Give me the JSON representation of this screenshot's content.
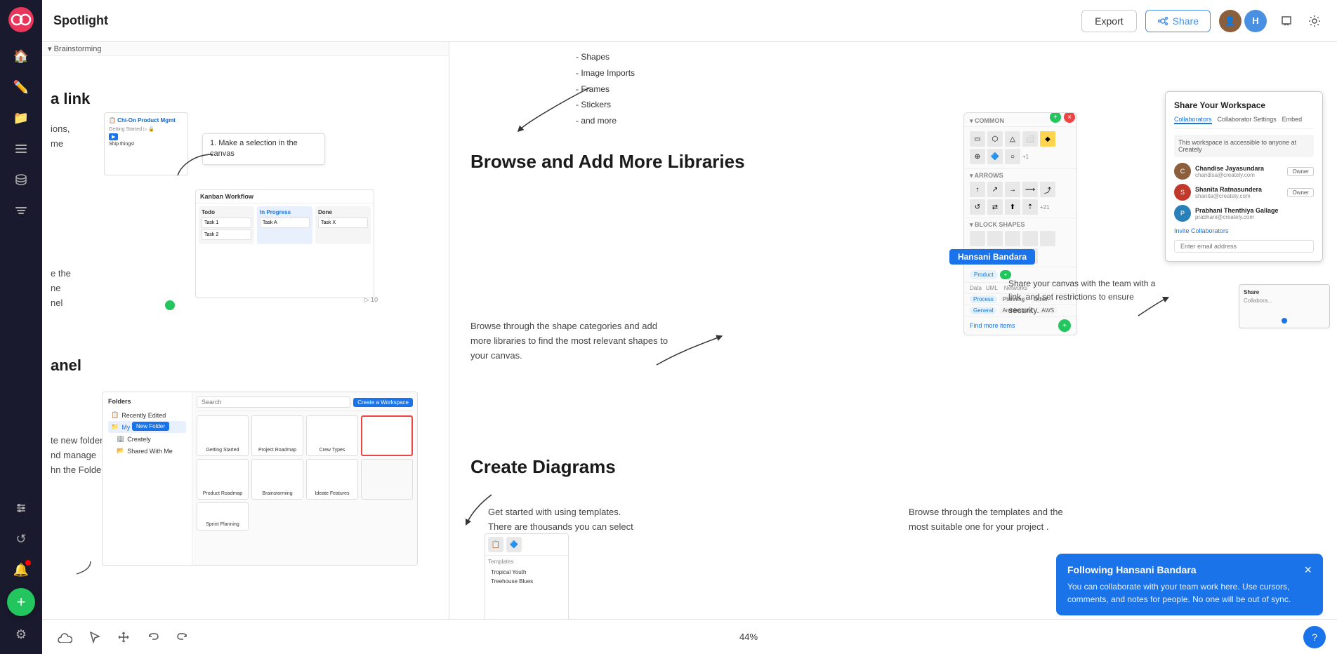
{
  "app": {
    "logo_alt": "Creately logo",
    "title": "Spotlight"
  },
  "topbar": {
    "title": "Spotlight",
    "export_label": "Export",
    "share_label": "Share",
    "avatar_alt": "User avatar"
  },
  "sidebar": {
    "items": [
      {
        "id": "home",
        "icon": "🏠",
        "label": "Home"
      },
      {
        "id": "draw",
        "icon": "✏️",
        "label": "Draw"
      },
      {
        "id": "folders",
        "icon": "📁",
        "label": "Folders"
      },
      {
        "id": "lists",
        "icon": "☰",
        "label": "Lists"
      },
      {
        "id": "database",
        "icon": "🗄️",
        "label": "Database"
      },
      {
        "id": "layers",
        "icon": "⊞",
        "label": "Layers"
      },
      {
        "id": "history",
        "icon": "↺",
        "label": "History"
      }
    ],
    "bottom": [
      {
        "id": "notifications",
        "icon": "🔔",
        "label": "Notifications"
      },
      {
        "id": "add",
        "icon": "+",
        "label": "Add"
      },
      {
        "id": "settings",
        "icon": "⚙",
        "label": "Settings"
      }
    ]
  },
  "breadcrumb": {
    "text": "▾ Brainstorming"
  },
  "canvas": {
    "shapes_list": {
      "items": [
        "- Shapes",
        "- Image Imports",
        "- Frames",
        "- Stickers",
        "- and more"
      ]
    },
    "annotation_1": {
      "text": "1. Make a selection in the canvas"
    },
    "annotation_link": "a link",
    "annotation_panel": "anel",
    "annotation_content_a": "ions,",
    "annotation_content_b": "me",
    "annotation_content_c": "e the\nne\nnel",
    "annotation_folder": "te new folders,\nnd manage\nhn the Folder"
  },
  "browse_section": {
    "title": "Browse and Add More Libraries",
    "description": "Browse through the shape categories and add more libraries to find the most relevant shapes to your canvas."
  },
  "share_panel": {
    "title": "Share Your Workspace",
    "tabs": [
      "Collaborators",
      "Collaborator Settings",
      "Embed"
    ],
    "note": "This workspace is accessible to anyone at Creately",
    "users": [
      {
        "name": "Chandise Jayasundara",
        "email": "chandisa@creately.com",
        "role": "Owner"
      },
      {
        "name": "Shanita Ratnasundera",
        "email": "shanita@creately.com",
        "role": "Owner"
      },
      {
        "name": "Prabhani Thenthiya Gallage",
        "email": "prabhani@creately.com",
        "role": ""
      }
    ],
    "invite_label": "Invite Collaborators",
    "share_canvas_desc": "Share your canvas with the team with a link, and set restrictions to ensure security."
  },
  "tooltip": {
    "label": "Hansani Bandara"
  },
  "following_notif": {
    "title": "Following Hansani Bandara",
    "close_label": "×",
    "body": "You can collaborate with your team work here. Use cursors, comments, and notes for people. No one will be out of sync."
  },
  "create_section": {
    "title": "Create Diagrams",
    "annotation_templates": "Get started with using templates. There are thousands you can select from.",
    "annotation_browse": "Browse through the templates and the most suitable one for your project ."
  },
  "bottom_toolbar": {
    "zoom_pct": "44%",
    "help_label": "?"
  }
}
